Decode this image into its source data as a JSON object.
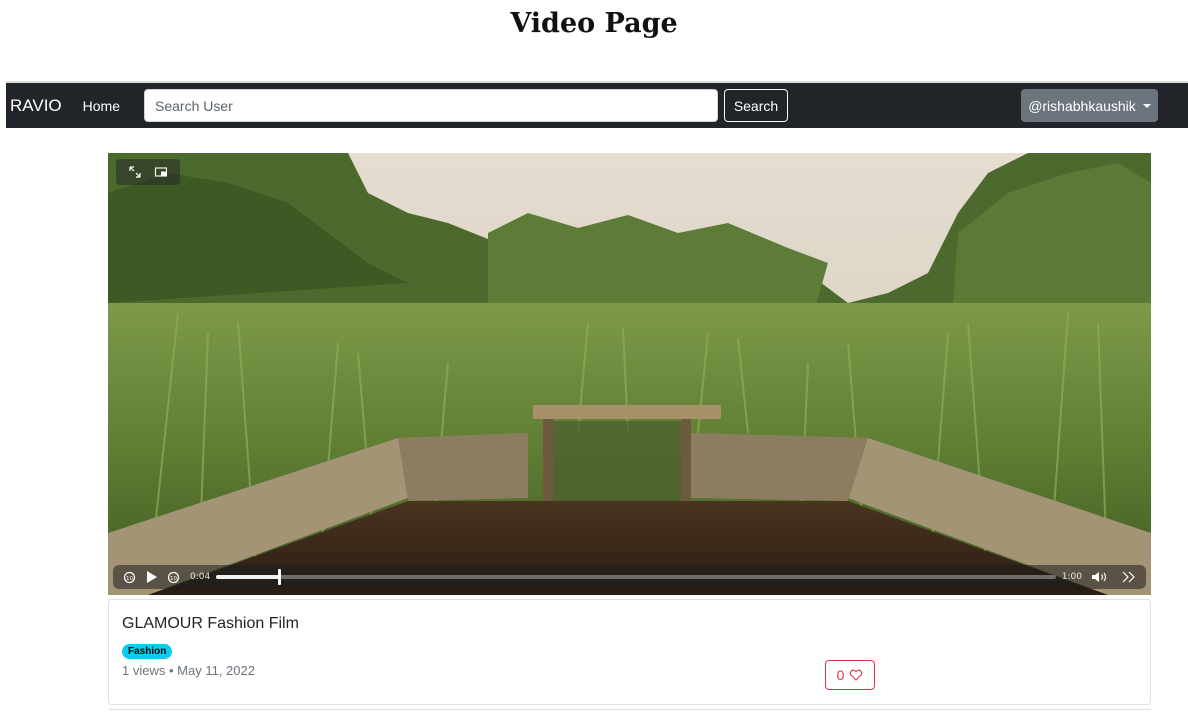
{
  "page": {
    "heading": "Video Page"
  },
  "navbar": {
    "brand": "RAVIO",
    "home": "Home",
    "search": {
      "placeholder": "Search User",
      "value": ""
    },
    "search_button": "Search",
    "user_menu": "@rishabhkaushik"
  },
  "player": {
    "current_time": "0:04",
    "duration": "1:00",
    "progress_fraction": 0.075,
    "icons": {
      "fullscreen": "expand-arrows-icon",
      "pip": "picture-in-picture-icon",
      "rewind": "rewind-10-icon",
      "play": "play-icon",
      "forward": "forward-10-icon",
      "volume": "volume-icon",
      "more": "double-chevron-right-icon"
    }
  },
  "video": {
    "title": "GLAMOUR Fashion Film",
    "category": "Fashion",
    "views": "1 views",
    "separator": "•",
    "date": "May 11, 2022",
    "likes": "0"
  },
  "colors": {
    "navbar": "#212529",
    "badge": "#0dcaf0",
    "like": "#dc3545",
    "user_button": "#6c757d"
  }
}
